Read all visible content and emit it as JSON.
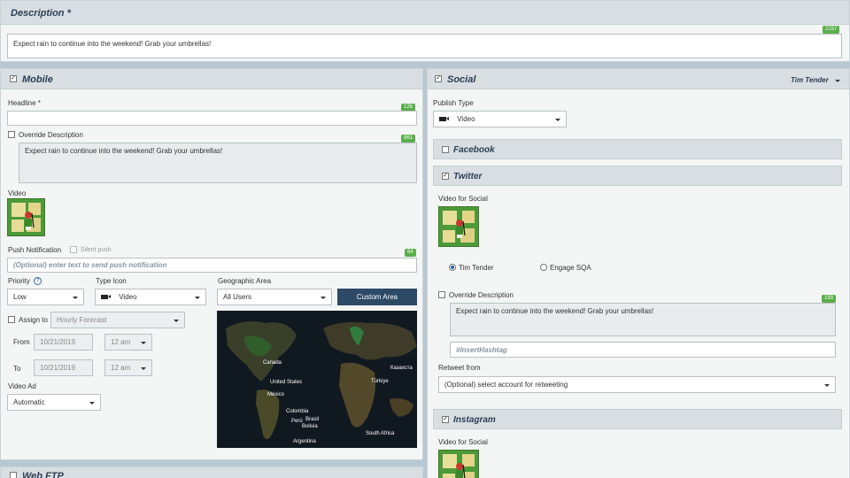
{
  "description": {
    "title": "Description *",
    "value": "Expect rain to continue into the weekend!  Grab your umbrellas!",
    "count": "2157"
  },
  "mobile": {
    "title": "Mobile",
    "headline_label": "Headline *",
    "headline_value": "",
    "headline_count": "126",
    "override_label": "Override Description",
    "override_value": "Expect rain to continue into the weekend!  Grab your umbrellas!",
    "override_count": "961",
    "video_label": "Video",
    "push_label": "Push Notification",
    "silent_push_label": "Silent push",
    "push_placeholder": "(Optional) enter text to send push notification",
    "push_count": "64",
    "priority_label": "Priority",
    "priority_value": "Low",
    "type_icon_label": "Type Icon",
    "type_icon_value": "Video",
    "geo_label": "Geographic Area",
    "geo_value": "All Users",
    "custom_area_button": "Custom Area",
    "assign_label": "Assign to",
    "assign_value": "Hourly Forecast",
    "from_label": "From",
    "from_date": "10/21/2019",
    "from_time": "12 am",
    "to_label": "To",
    "to_date": "10/21/2019",
    "to_time": "12 am",
    "video_ad_label": "Video Ad",
    "video_ad_value": "Automatic",
    "map_labels": {
      "canada": "Canada",
      "usa": "United States",
      "mexico": "México",
      "colombia": "Colombia",
      "peru": "Perú",
      "brasil": "Brasil",
      "bolivia": "Bolivia",
      "argentina": "Argentina",
      "turkey": "Türkiye",
      "kazakhstan": "Казахста",
      "south_africa": "South Africa"
    }
  },
  "web_ftp": {
    "title": "Web FTP"
  },
  "social": {
    "title": "Social",
    "account": "Tim Tender",
    "publish_type_label": "Publish Type",
    "publish_type_value": "Video",
    "facebook_title": "Facebook",
    "twitter": {
      "title": "Twitter",
      "video_label": "Video for Social",
      "radio_1": "Tim Tender",
      "radio_2": "Engage SQA",
      "override_label": "Override Description",
      "override_value": "Expect rain to continue into the weekend!  Grab your umbrellas!",
      "override_count": "193",
      "hashtag_placeholder": "#InsertHashtag",
      "retweet_label": "Retweet from",
      "retweet_placeholder": "(Optional) select account for retweeting"
    },
    "instagram": {
      "title": "Instagram",
      "video_label": "Video for Social"
    }
  },
  "colors": {
    "header_bg": "#d8dee1",
    "title_color": "#2c3e57",
    "counter_green": "#5aae4b",
    "button_navy": "#2c4a66"
  }
}
